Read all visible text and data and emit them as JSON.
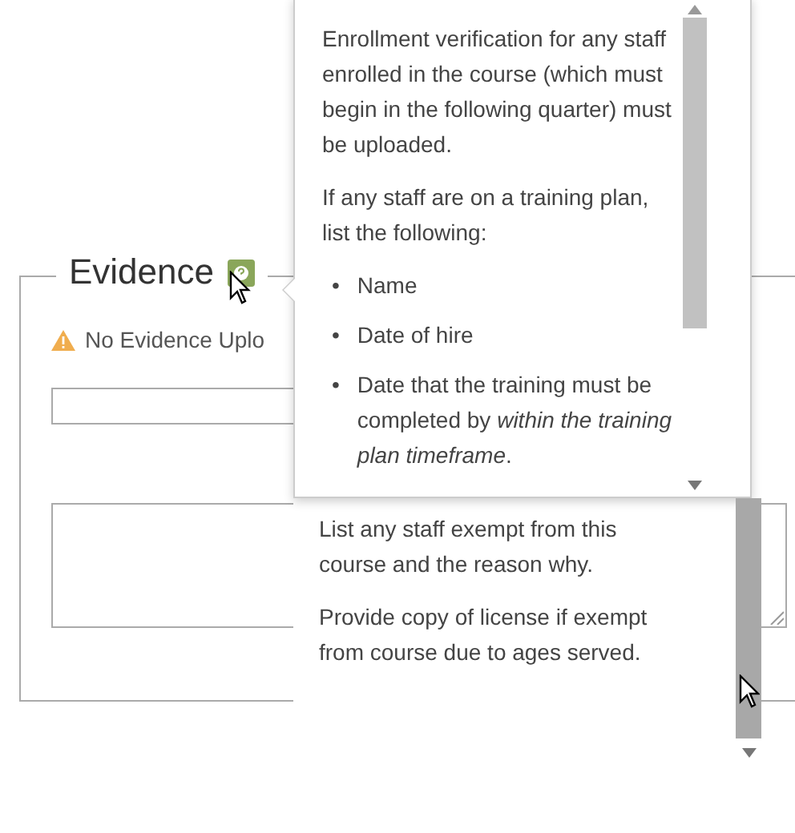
{
  "evidence": {
    "legend": "Evidence",
    "warning": "No Evidence Uplo"
  },
  "help_popup": {
    "paragraphs": [
      "Enrollment verification for any staff enrolled in the course (which must begin in the following quarter) must be uploaded.",
      "If any staff are on a training plan, list the following:"
    ],
    "bullets": [
      {
        "marker": "•",
        "text": "Name"
      },
      {
        "marker": "•",
        "text": "Date of hire"
      },
      {
        "marker": "•",
        "text": "Date that the training must be completed by *within the training plan timeframe*."
      }
    ]
  },
  "help_popup_continued": {
    "paragraphs": [
      "List any staff exempt from this course and the reason why.",
      "Provide copy of license if exempt from course due to ages served."
    ]
  }
}
